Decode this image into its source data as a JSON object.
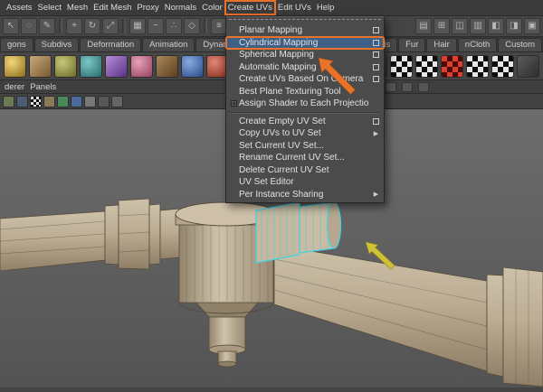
{
  "menubar": {
    "items": [
      {
        "label": "Assets"
      },
      {
        "label": "Select"
      },
      {
        "label": "Mesh"
      },
      {
        "label": "Edit Mesh"
      },
      {
        "label": "Proxy"
      },
      {
        "label": "Normals"
      },
      {
        "label": "Color"
      },
      {
        "label": "Create UVs",
        "annotated": true
      },
      {
        "label": "Edit UVs"
      },
      {
        "label": "Help"
      }
    ]
  },
  "toolbar": {
    "left_icons": [
      {
        "name": "select-tool-icon",
        "glyph": "↖"
      },
      {
        "name": "lasso-tool-icon",
        "glyph": "◌"
      },
      {
        "name": "paint-select-tool-icon",
        "glyph": "✎"
      },
      {
        "name": "move-tool-icon",
        "glyph": "+"
      },
      {
        "name": "rotate-tool-icon",
        "glyph": "↻"
      },
      {
        "name": "scale-tool-icon",
        "glyph": "⤢"
      },
      {
        "name": "snap-grid-icon",
        "glyph": "▦"
      },
      {
        "name": "snap-curve-icon",
        "glyph": "~"
      },
      {
        "name": "snap-point-icon",
        "glyph": "∴"
      },
      {
        "name": "snap-view-plane-icon",
        "glyph": "◇"
      },
      {
        "name": "construction-history-icon",
        "glyph": "≡"
      },
      {
        "name": "render-current-frame-icon",
        "glyph": "▣"
      },
      {
        "name": "ipr-render-icon",
        "glyph": "▶"
      },
      {
        "name": "render-settings-icon",
        "glyph": "☰"
      }
    ],
    "right_icons": [
      {
        "name": "single-pane-layout-icon",
        "glyph": "▤"
      },
      {
        "name": "four-pane-layout-icon",
        "glyph": "⊞"
      },
      {
        "name": "persp-outliner-layout-icon",
        "glyph": "◫"
      },
      {
        "name": "hypershade-layout-icon",
        "glyph": "▥"
      },
      {
        "name": "graph-editor-layout-icon",
        "glyph": "◧"
      },
      {
        "name": "outliner-layout-icon",
        "glyph": "◨"
      },
      {
        "name": "script-editor-icon",
        "glyph": "▣"
      }
    ]
  },
  "shelf_tabs": {
    "left": [
      {
        "label": "gons"
      },
      {
        "label": "Subdivs"
      },
      {
        "label": "Deformation"
      },
      {
        "label": "Animation"
      },
      {
        "label": "Dynamics"
      }
    ],
    "right": [
      {
        "label": "Fluids"
      },
      {
        "label": "Fur"
      },
      {
        "label": "Hair"
      },
      {
        "label": "nCloth"
      },
      {
        "label": "Custom"
      }
    ]
  },
  "panel_menus": {
    "items": [
      {
        "label": "derer"
      },
      {
        "label": "Panels"
      }
    ]
  },
  "create_uvs_menu": {
    "selected_item": "Cylindrical Mapping",
    "items": [
      {
        "label": "Planar Mapping",
        "option_box": true
      },
      {
        "label": "Cylindrical Mapping",
        "option_box": true,
        "selected": true
      },
      {
        "label": "Spherical Mapping",
        "option_box": true
      },
      {
        "label": "Automatic Mapping",
        "option_box": true
      },
      {
        "label": "Create UVs Based On Camera",
        "option_box": true
      },
      {
        "label": "Best Plane Texturing Tool",
        "option_box": false
      },
      {
        "label": "Assign Shader to Each Projection",
        "checkbox": true
      },
      {
        "label": "Create Empty UV Set",
        "option_box": true
      },
      {
        "label": "Copy UVs to UV Set",
        "submenu": true
      },
      {
        "label": "Set Current UV Set...",
        "option_box": false
      },
      {
        "label": "Rename Current UV Set...",
        "option_box": false
      },
      {
        "label": "Delete Current UV Set",
        "option_box": false
      },
      {
        "label": "UV Set Editor",
        "option_box": false
      },
      {
        "label": "Per Instance Sharing",
        "submenu": true
      }
    ]
  },
  "annotations": {
    "orange_box_color": "#e8722a",
    "orange_arrow_color": "#e8722a",
    "yellow_arrow_color": "#cfc138"
  },
  "colors": {
    "menu_highlight_blue": "#3e5f86",
    "selection_wireframe_cyan": "#41d4e4",
    "model_surface_tan": "#c2b29a",
    "viewport_gray": "#5f5f5f"
  }
}
